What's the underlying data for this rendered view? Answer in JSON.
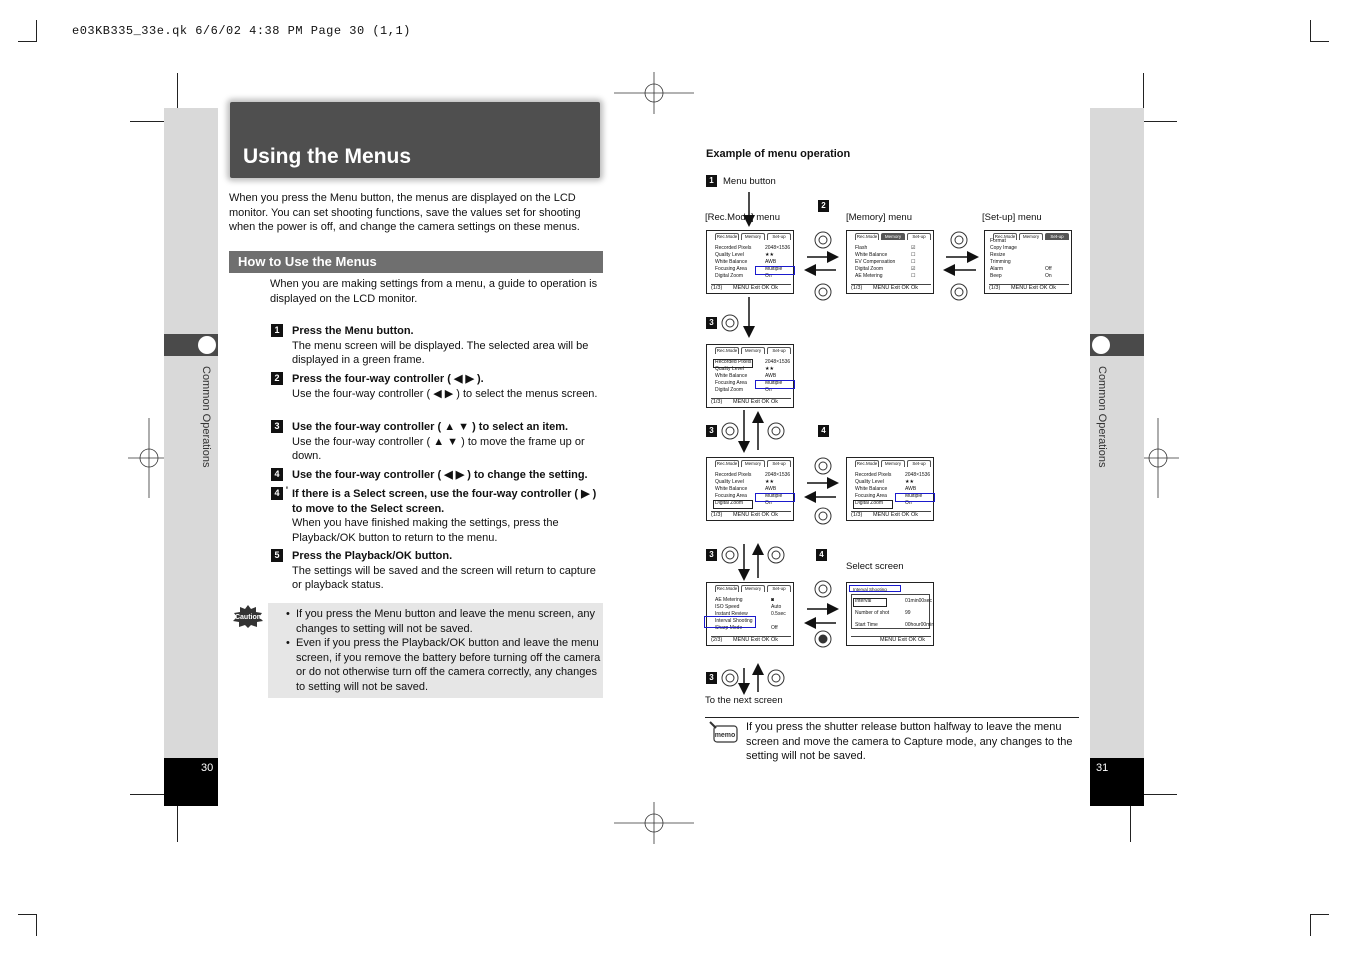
{
  "header_line": "e03KB335_33e.qk  6/6/02 4:38 PM  Page 30 (1,1)",
  "left_page": {
    "sidebar_label": "Common Operations",
    "page_number": "30",
    "title": "Using the Menus",
    "intro": "When you press the Menu button, the menus are displayed on the LCD monitor. You can set shooting functions, save the values set for shooting when the power is off, and change the camera settings on these menus.",
    "section_heading": "How to Use the Menus",
    "section_intro": "When you are making settings from a menu, a guide to operation is displayed on the LCD monitor.",
    "steps": [
      {
        "num": "1",
        "heading": "Press the Menu button.",
        "body": "The menu screen will be displayed. The selected area will be displayed in a green frame."
      },
      {
        "num": "2",
        "heading": "Press the four-way controller ( ◀ ▶ ).",
        "body": "Use the four-way controller ( ◀ ▶ ) to select the menus screen."
      },
      {
        "num": "3",
        "heading": "Use the four-way controller ( ▲ ▼ ) to select an item.",
        "body": "Use the four-way controller ( ▲ ▼ ) to move the frame up or down."
      },
      {
        "num": "4",
        "heading": "Use the four-way controller ( ◀ ▶ ) to change the setting.",
        "body": ""
      },
      {
        "num": "4",
        "heading": "If there is a Select screen, use the four-way controller ( ▶ ) to move to the Select screen.",
        "body": "When you have finished making the settings, press the Playback/OK button to return to the menu."
      },
      {
        "num": "5",
        "heading": "Press the Playback/OK button.",
        "body": "The settings will be saved and the screen will return to capture or playback status."
      }
    ],
    "caution_label": "Caution",
    "caution_items": [
      "If you press the Menu button and leave the menu screen, any changes to setting will not be saved.",
      "Even if you press the Playback/OK button and leave the menu screen, if you remove the battery before turning off the camera or do not otherwise turn off the camera correctly, any changes to setting will not be saved."
    ]
  },
  "right_page": {
    "sidebar_label": "Common Operations",
    "page_number": "31",
    "example_heading": "Example of menu operation",
    "menu_button_label": "Menu button",
    "rec_mode_menu": "[Rec.Mode] menu",
    "memory_menu": "[Memory] menu",
    "setup_menu": "[Set-up] menu",
    "select_screen": "Select screen",
    "next_screen": "To the next screen",
    "memo_label": "memo",
    "memo_text": "If you press the shutter release button halfway to leave the menu screen and move the camera to Capture mode, any changes to the setting will not be saved.",
    "lcd": {
      "tabs": [
        "Rec.Mode",
        "Memory",
        "Set-up"
      ],
      "exit": "Exit",
      "ok": "Ok",
      "menu_key": "MENU",
      "ok_key": "OK",
      "page_1": "(1/3)",
      "page_2": "(2/3)",
      "rec_rows": [
        {
          "k": "Recorded Pixels",
          "v": "2048×1536"
        },
        {
          "k": "Quality Level",
          "v": "★★"
        },
        {
          "k": "White Balance",
          "v": "AWB"
        },
        {
          "k": "Focusing Area",
          "v": "Multiple"
        },
        {
          "k": "Digital Zoom",
          "v": "On"
        }
      ],
      "memory_rows": [
        "Flash",
        "White Balance",
        "EV Compensation",
        "Digital Zoom",
        "AE Metering"
      ],
      "setup_rows": [
        {
          "k": "Format",
          "v": ""
        },
        {
          "k": "Copy Image",
          "v": ""
        },
        {
          "k": "Resize",
          "v": ""
        },
        {
          "k": "Trimming",
          "v": ""
        },
        {
          "k": "Alarm",
          "v": "Off"
        },
        {
          "k": "Beep",
          "v": "On"
        }
      ],
      "rec2_rows": [
        {
          "k": "AE Metering",
          "v": "◙"
        },
        {
          "k": "ISO Speed",
          "v": "Auto"
        },
        {
          "k": "Instant Review",
          "v": "0.5sec"
        },
        {
          "k": "Interval Shooting",
          "v": ""
        },
        {
          "k": "Sharp Mode",
          "v": "Off"
        }
      ],
      "interval_title": "Interval Shooting",
      "interval_rows": [
        {
          "k": "Interval",
          "v": "01min00sec"
        },
        {
          "k": "Number of shot",
          "v": "99"
        },
        {
          "k": "Start Time",
          "v": "00hour00min"
        }
      ]
    }
  }
}
